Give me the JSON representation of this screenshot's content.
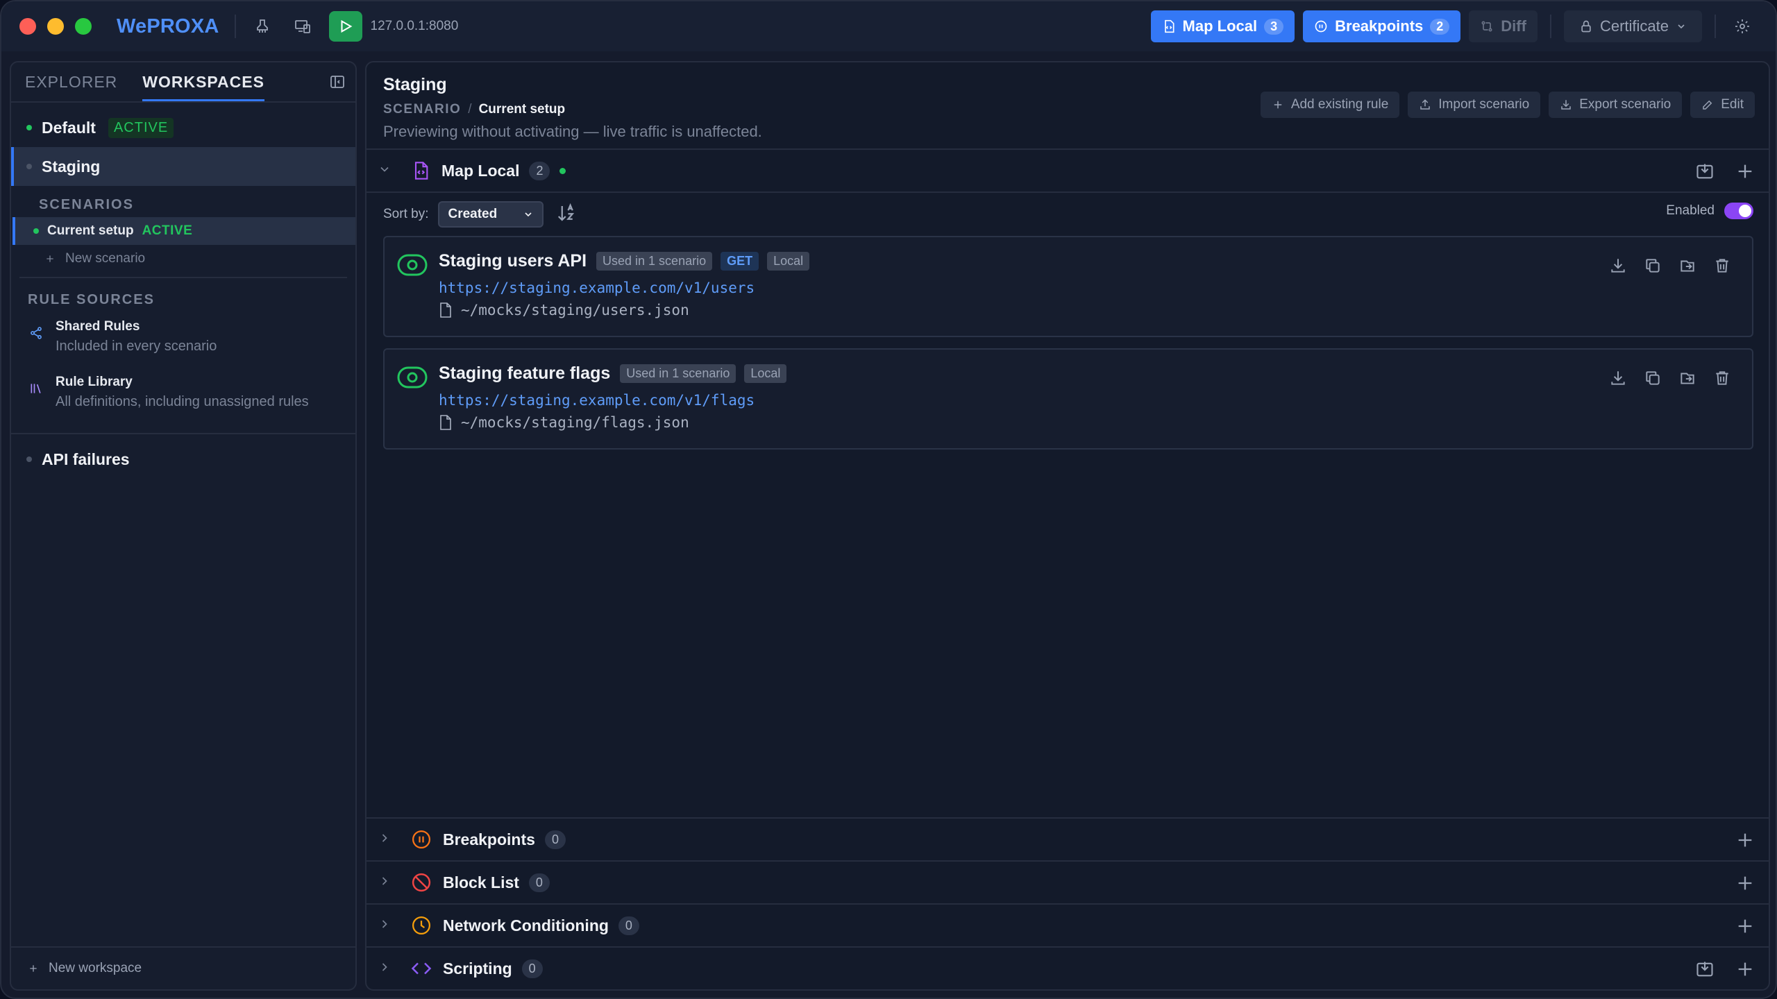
{
  "app": {
    "name": "WePROXA",
    "address": "127.0.0.1:8080"
  },
  "toolbar": {
    "map_local_label": "Map Local",
    "map_local_count": "3",
    "breakpoints_label": "Breakpoints",
    "breakpoints_count": "2",
    "diff_label": "Diff",
    "certificate_label": "Certificate"
  },
  "sidebar": {
    "tabs": [
      "EXPLORER",
      "WORKSPACES"
    ],
    "active_tab": "WORKSPACES",
    "workspaces": [
      {
        "name": "Default",
        "badge": "ACTIVE"
      },
      {
        "name": "Staging"
      },
      {
        "name": "API failures"
      }
    ],
    "scenarios_label": "SCENARIOS",
    "scenarios": [
      {
        "name": "Current setup",
        "badge": "ACTIVE"
      }
    ],
    "new_scenario_label": "New scenario",
    "rule_sources_label": "RULE SOURCES",
    "rule_sources": [
      {
        "title": "Shared Rules",
        "subtitle": "Included in every scenario"
      },
      {
        "title": "Rule Library",
        "subtitle": "All definitions, including unassigned rules"
      }
    ],
    "new_workspace_label": "New workspace"
  },
  "main": {
    "title": "Staging",
    "breadcrumb_key": "SCENARIO",
    "breadcrumb_sep": "/",
    "breadcrumb_value": "Current setup",
    "preview_note": "Previewing without activating — live traffic is unaffected.",
    "actions": [
      "Add existing rule",
      "Import scenario",
      "Export scenario",
      "Edit"
    ],
    "map_local": {
      "name": "Map Local",
      "count": "2",
      "sort_label": "Sort by:",
      "sort_value": "Created",
      "enabled_label": "Enabled",
      "enabled": true,
      "rules": [
        {
          "title": "Staging users API",
          "usage": "Used in 1 scenario",
          "method": "GET",
          "kind": "Local",
          "url": "https://staging.example.com/v1/users",
          "path": "~/mocks/staging/users.json"
        },
        {
          "title": "Staging feature flags",
          "usage": "Used in 1 scenario",
          "kind": "Local",
          "url": "https://staging.example.com/v1/flags",
          "path": "~/mocks/staging/flags.json"
        }
      ]
    },
    "collapsed_sections": [
      {
        "name": "Breakpoints",
        "count": "0",
        "icon": "pause-circle-icon",
        "color": "#f97316"
      },
      {
        "name": "Block List",
        "count": "0",
        "icon": "block-icon",
        "color": "#ef4444"
      },
      {
        "name": "Network Conditioning",
        "count": "0",
        "icon": "clock-icon",
        "color": "#f59e0b"
      },
      {
        "name": "Scripting",
        "count": "0",
        "icon": "code-icon",
        "color": "#8b5cf6"
      }
    ]
  },
  "colors": {
    "accent": "#3478f6",
    "active_green": "#22c55e",
    "toggle_purple": "#8b45f5"
  }
}
